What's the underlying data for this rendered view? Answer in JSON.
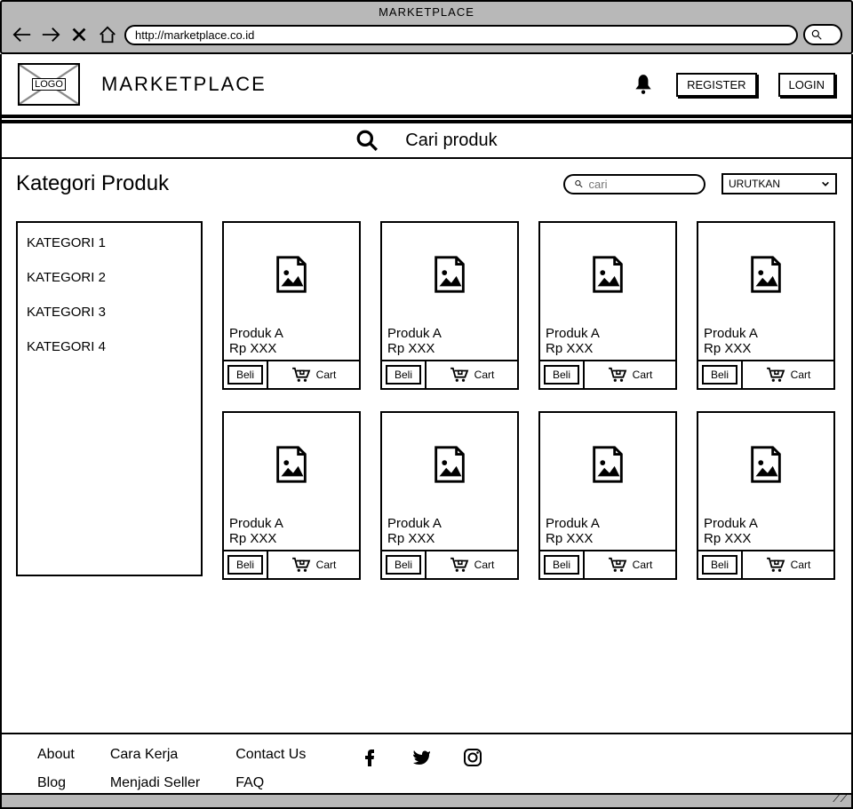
{
  "window": {
    "title": "MARKETPLACE",
    "url": "http://marketplace.co.id"
  },
  "header": {
    "logo_text": "LOGO",
    "brand": "MARKETPLACE",
    "register_label": "REGISTER",
    "login_label": "LOGIN"
  },
  "searchbar": {
    "placeholder": "Cari produk"
  },
  "page": {
    "title": "Kategori Produk",
    "filter_placeholder": "cari",
    "sort_label": "URUTKAN"
  },
  "sidebar": {
    "items": [
      {
        "label": "KATEGORI 1"
      },
      {
        "label": "KATEGORI 2"
      },
      {
        "label": "KATEGORI 3"
      },
      {
        "label": "KATEGORI 4"
      }
    ]
  },
  "products": [
    {
      "name": "Produk A",
      "price": "Rp XXX",
      "buy_label": "Beli",
      "cart_label": "Cart"
    },
    {
      "name": "Produk A",
      "price": "Rp XXX",
      "buy_label": "Beli",
      "cart_label": "Cart"
    },
    {
      "name": "Produk A",
      "price": "Rp XXX",
      "buy_label": "Beli",
      "cart_label": "Cart"
    },
    {
      "name": "Produk A",
      "price": "Rp XXX",
      "buy_label": "Beli",
      "cart_label": "Cart"
    },
    {
      "name": "Produk A",
      "price": "Rp XXX",
      "buy_label": "Beli",
      "cart_label": "Cart"
    },
    {
      "name": "Produk A",
      "price": "Rp XXX",
      "buy_label": "Beli",
      "cart_label": "Cart"
    },
    {
      "name": "Produk A",
      "price": "Rp XXX",
      "buy_label": "Beli",
      "cart_label": "Cart"
    },
    {
      "name": "Produk A",
      "price": "Rp XXX",
      "buy_label": "Beli",
      "cart_label": "Cart"
    }
  ],
  "footer": {
    "col1": [
      {
        "label": "About"
      },
      {
        "label": "Blog"
      }
    ],
    "col2": [
      {
        "label": "Cara Kerja"
      },
      {
        "label": "Menjadi Seller"
      }
    ],
    "col3": [
      {
        "label": "Contact Us"
      },
      {
        "label": "FAQ"
      }
    ]
  }
}
